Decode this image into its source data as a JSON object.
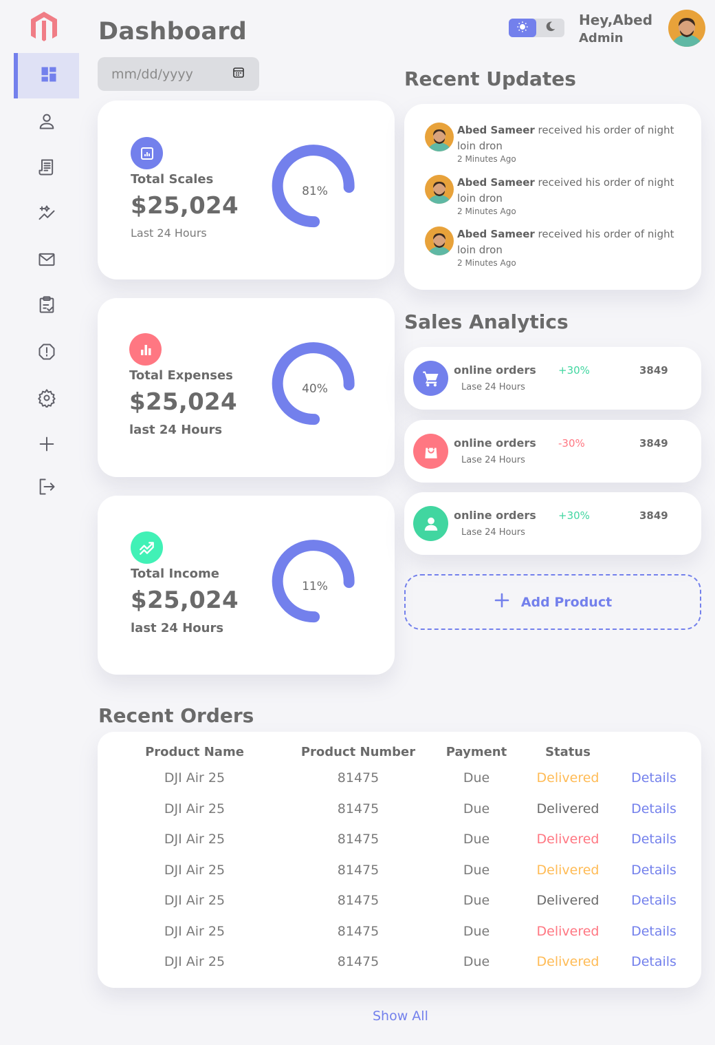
{
  "header": {
    "title": "Dashboard",
    "date_placeholder": "mm/dd/yyyy",
    "greeting": "Hey,Abed",
    "role": "Admin"
  },
  "sidebar": {
    "items": [
      {
        "name": "dashboard",
        "icon": "dashboard-icon",
        "active": true
      },
      {
        "name": "customers",
        "icon": "user-icon"
      },
      {
        "name": "orders",
        "icon": "receipt-icon"
      },
      {
        "name": "analytics",
        "icon": "sparkle-icon"
      },
      {
        "name": "messages",
        "icon": "mail-icon"
      },
      {
        "name": "products",
        "icon": "clipboard-check-icon"
      },
      {
        "name": "reports",
        "icon": "alert-icon"
      },
      {
        "name": "settings",
        "icon": "gear-icon"
      },
      {
        "name": "add",
        "icon": "plus-icon"
      },
      {
        "name": "logout",
        "icon": "logout-icon"
      }
    ]
  },
  "stats": [
    {
      "label": "Total Scales",
      "value": "$25,024",
      "sub": "Last 24 Hours",
      "percent": 81,
      "percent_text": "81%",
      "color": "#7380ec",
      "icon": "chart-icon"
    },
    {
      "label": "Total Expenses",
      "value": "$25,024",
      "sub": "last 24 Hours",
      "percent": 40,
      "percent_text": "40%",
      "color": "#ff7782",
      "icon": "bar-chart-icon"
    },
    {
      "label": "Total Income",
      "value": "$25,024",
      "sub": "last 24 Hours",
      "percent": 11,
      "percent_text": "11%",
      "color": "#41f1b6",
      "icon": "trending-icon"
    }
  ],
  "updates": {
    "title": "Recent Updates",
    "items": [
      {
        "name": "Abed Sameer",
        "text": " received his order of night loin dron",
        "time": "2 Minutes Ago"
      },
      {
        "name": "Abed Sameer",
        "text": " received his order of night loin dron",
        "time": "2 Minutes Ago"
      },
      {
        "name": "Abed Sameer",
        "text": " received his order of night loin dron",
        "time": "2 Minutes Ago"
      }
    ]
  },
  "analytics": {
    "title": "Sales Analytics",
    "items": [
      {
        "title": "online orders",
        "sub": "Lase 24 Hours",
        "pct": "+30%",
        "count": "3849",
        "color": "#7380ec",
        "pct_color": "#41d6a0",
        "icon": "cart-icon"
      },
      {
        "title": "online orders",
        "sub": "Lase 24 Hours",
        "pct": "-30%",
        "count": "3849",
        "color": "#ff7782",
        "pct_color": "#ff7782",
        "icon": "bag-icon"
      },
      {
        "title": "online orders",
        "sub": "Lase 24 Hours",
        "pct": "+30%",
        "count": "3849",
        "color": "#41d6a0",
        "pct_color": "#41d6a0",
        "icon": "person-icon"
      }
    ],
    "add_product": "Add Product"
  },
  "orders": {
    "title": "Recent Orders",
    "headers": [
      "Product Name",
      "Product Number",
      "Payment",
      "Status"
    ],
    "rows": [
      {
        "product": "DJI Air 25",
        "number": "81475",
        "payment": "Due",
        "status": "Delivered",
        "status_color": "#ffbb55",
        "action": "Details"
      },
      {
        "product": "DJI Air 25",
        "number": "81475",
        "payment": "Due",
        "status": "Delivered",
        "status_color": "#6a6a6a",
        "action": "Details"
      },
      {
        "product": "DJI Air 25",
        "number": "81475",
        "payment": "Due",
        "status": "Delivered",
        "status_color": "#ff7782",
        "action": "Details"
      },
      {
        "product": "DJI Air 25",
        "number": "81475",
        "payment": "Due",
        "status": "Delivered",
        "status_color": "#ffbb55",
        "action": "Details"
      },
      {
        "product": "DJI Air 25",
        "number": "81475",
        "payment": "Due",
        "status": "Delivered",
        "status_color": "#6a6a6a",
        "action": "Details"
      },
      {
        "product": "DJI Air 25",
        "number": "81475",
        "payment": "Due",
        "status": "Delivered",
        "status_color": "#ff7782",
        "action": "Details"
      },
      {
        "product": "DJI Air 25",
        "number": "81475",
        "payment": "Due",
        "status": "Delivered",
        "status_color": "#ffbb55",
        "action": "Details"
      }
    ],
    "show_all": "Show All"
  },
  "colors": {
    "primary": "#7380ec",
    "danger": "#ff7782",
    "success": "#41f1b6",
    "warning": "#ffbb55"
  }
}
